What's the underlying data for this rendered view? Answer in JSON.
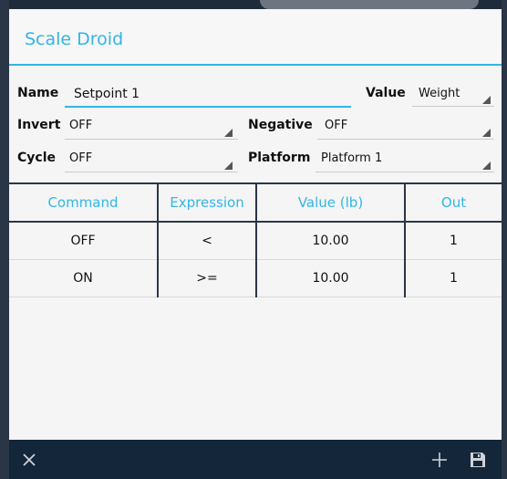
{
  "dialog": {
    "title": "Scale Droid"
  },
  "fields": {
    "name_label": "Name",
    "name_value": "Setpoint 1",
    "value_label": "Value",
    "value_selected": "Weight",
    "invert_label": "Invert",
    "invert_selected": "OFF",
    "negative_label": "Negative",
    "negative_selected": "OFF",
    "cycle_label": "Cycle",
    "cycle_selected": "OFF",
    "platform_label": "Platform",
    "platform_selected": "Platform 1"
  },
  "table": {
    "headers": [
      "Command",
      "Expression",
      "Value (lb)",
      "Out"
    ],
    "rows": [
      [
        "OFF",
        "<",
        "10.00",
        "1"
      ],
      [
        "ON",
        ">=",
        "10.00",
        "1"
      ]
    ]
  },
  "bottombar": {
    "close_icon": "close-icon",
    "add_icon": "plus-icon",
    "save_icon": "save-icon"
  },
  "colors": {
    "accent": "#33b5e5",
    "bar": "#13263a"
  }
}
